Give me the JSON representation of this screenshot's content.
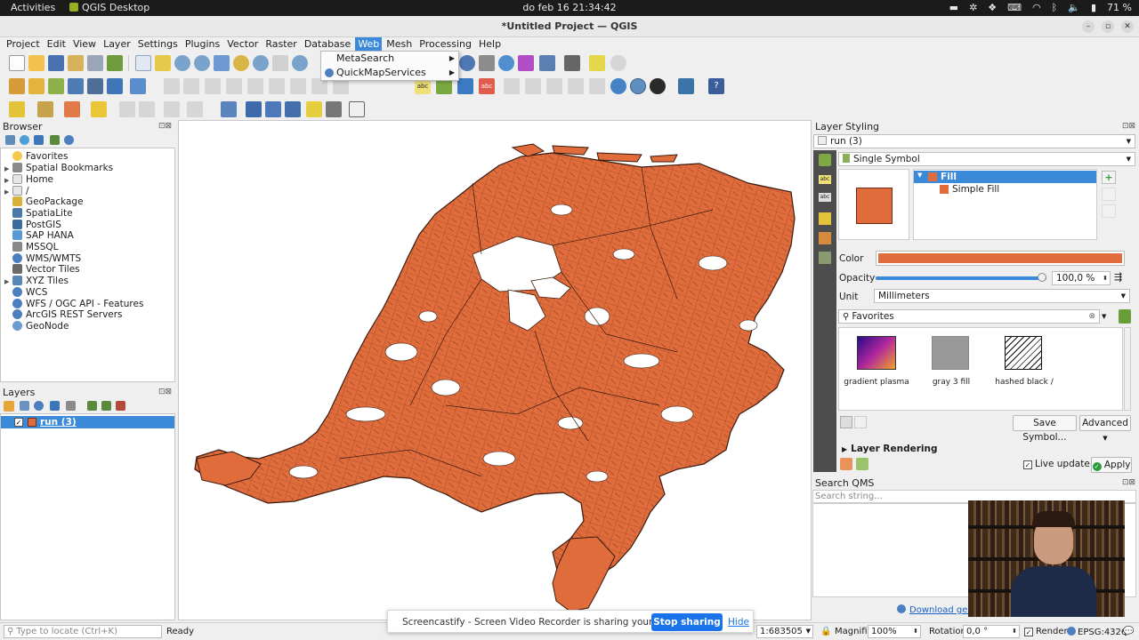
{
  "gnome": {
    "activities": "Activities",
    "app_name": "QGIS Desktop",
    "clock": "do feb 16  21:34:42",
    "battery": "71 %"
  },
  "window": {
    "title": "*Untitled Project — QGIS"
  },
  "menubar": {
    "items": [
      "Project",
      "Edit",
      "View",
      "Layer",
      "Settings",
      "Plugins",
      "Vector",
      "Raster",
      "Database",
      "Web",
      "Mesh",
      "Processing",
      "Help"
    ],
    "active": "Web"
  },
  "web_menu": {
    "items": [
      "MetaSearch",
      "QuickMapServices"
    ]
  },
  "browser": {
    "title": "Browser",
    "items": [
      "Favorites",
      "Spatial Bookmarks",
      "Home",
      "/",
      "GeoPackage",
      "SpatiaLite",
      "PostGIS",
      "SAP HANA",
      "MSSQL",
      "WMS/WMTS",
      "Vector Tiles",
      "XYZ Tiles",
      "WCS",
      "WFS / OGC API - Features",
      "ArcGIS REST Servers",
      "GeoNode"
    ]
  },
  "layers": {
    "title": "Layers",
    "items": [
      {
        "name": "run (3)",
        "checked": true,
        "selected": true
      }
    ]
  },
  "styling": {
    "title": "Layer Styling",
    "layer_select": "run (3)",
    "renderer": "Single Symbol",
    "tree_fill": "Fill",
    "tree_simple_fill": "Simple Fill",
    "color_label": "Color",
    "opacity_label": "Opacity",
    "opacity_value": "100,0 %",
    "opacity_fraction": 1.0,
    "unit_label": "Unit",
    "unit_value": "Millimeters",
    "favorites_label": "Favorites",
    "symbols": [
      {
        "name": "gradient  plasma",
        "kind": "gradient"
      },
      {
        "name": "gray 3 fill",
        "kind": "gray"
      },
      {
        "name": "hashed black /",
        "kind": "hashed"
      }
    ],
    "save_symbol": "Save Symbol...",
    "advanced": "Advanced",
    "layer_rendering": "Layer Rendering",
    "live_update": "Live update",
    "apply": "Apply",
    "fill_color": "#e06c3c"
  },
  "qms": {
    "title": "Search QMS",
    "placeholder": "Search string...",
    "download": "Download geo"
  },
  "statusbar": {
    "locate_placeholder": "Type to locate (Ctrl+K)",
    "ready": "Ready",
    "scale": "1:683505",
    "magnifier_label": "Magnifier",
    "magnifier_value": "100%",
    "rotation_label": "Rotation",
    "rotation_value": "0,0 °",
    "render_label": "Render",
    "crs": "EPSG:4326"
  },
  "share": {
    "message": "Screencastify - Screen Video Recorder is sharing your screen.",
    "stop": "Stop sharing",
    "hide": "Hide"
  },
  "colors": {
    "accent": "#3a8ad9",
    "map_fill": "#e06c3c",
    "map_stroke": "#3a1a0e"
  }
}
